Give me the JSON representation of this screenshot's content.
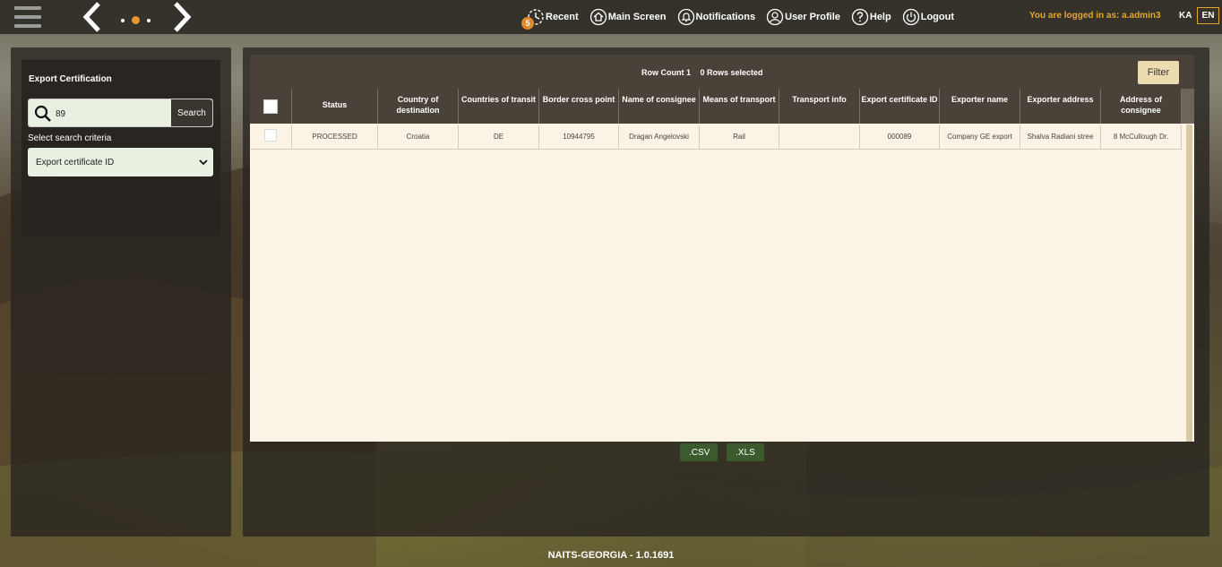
{
  "topbar": {
    "menu": [
      {
        "label": "Recent",
        "icon": "recent-icon",
        "badge": "5"
      },
      {
        "label": "Main Screen",
        "icon": "home-icon"
      },
      {
        "label": "Notifications",
        "icon": "bell-icon"
      },
      {
        "label": "User Profile",
        "icon": "user-icon"
      },
      {
        "label": "Help",
        "icon": "help-icon"
      },
      {
        "label": "Logout",
        "icon": "power-icon"
      }
    ],
    "logged_in_text": "You are logged in as: a.admin3",
    "lang_ka": "KA",
    "lang_en": "EN",
    "accent_color": "#e3a72f"
  },
  "sidebar": {
    "title": "Export Certification",
    "search_value": "89",
    "search_button": "Search",
    "criteria_label": "Select search criteria",
    "criteria_selected": "Export certificate ID"
  },
  "grid": {
    "row_count": "Row Count 1",
    "rows_selected": "0 Rows selected",
    "filter_label": "Filter",
    "columns": [
      "Status",
      "Country of destination",
      "Countries of transit",
      "Border cross point",
      "Name of consignee",
      "Means of transport",
      "Transport info",
      "Export certificate ID",
      "Exporter name",
      "Exporter address",
      "Address of consignee"
    ],
    "rows": [
      [
        "PROCESSED",
        "Croatia",
        "DE",
        "10944795",
        "Dragan Angelovski",
        "Rail",
        "",
        "000089",
        "Company GE export",
        "Shalva Radiani stree",
        "8 McCullough Dr."
      ]
    ]
  },
  "export": {
    "csv": ".CSV",
    "xls": ".XLS"
  },
  "footer": "NAITS-GEORGIA - 1.0.1691"
}
